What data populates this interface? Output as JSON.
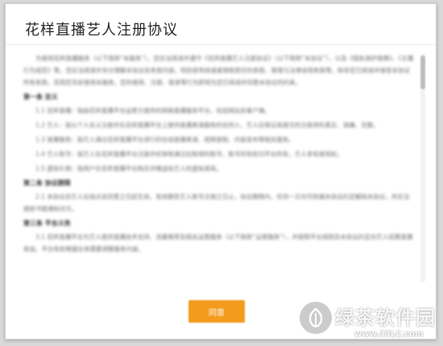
{
  "dialog": {
    "title": "花样直播艺人注册协议",
    "agree_button": "同意"
  },
  "agreement": {
    "intro": "为使用花样直播服务（以下简称“本服务”），您应当阅读并遵守《花样直播艺人注册协议》（以下简称“本协议”），以及《隐私保护政策》、《主播行为规范》等。您应当阅读并充分理解本协议各条款内容，特别是免除或者限制责任的条款、管辖与法律适用条款等。除非您已阅读并接受本协议所有条款，否则您无权使用本服务。您的使用、注册、登录等行为即视为您已阅读并同意本协议的约束。",
    "sections": [
      {
        "heading": "第一条 定义",
        "paragraphs": [
          "1.1 花样直播：指由花样直播平台运营方提供的网络直播服务平台，包括网站及客户端。",
          "1.2 艺人：指以个人名义注册并在花样直播平台上提供直播表演服务的自然人，艺人应保证其提交的注册资料真实、准确、完整。",
          "1.3 直播服务：指艺人通过花样直播平台进行的在线直播表演、视频录制、内容发布等相关服务。",
          "1.4 艺人账号：指艺人在花样直播平台注册并经审核通过后取得的账号，账号所有权归平台所有，艺人享有使用权。",
          "1.5 虚拟礼物：指用户在花样直播平台购买并赠送给艺人的虚拟道具。"
        ]
      },
      {
        "heading": "第二条 协议期限",
        "paragraphs": [
          "2.1 本协议自艺人在线点击同意之日起生效，有效期至艺人账号注销之日止。协议期限内，任何一方均可依据本协议约定解除本协议，并应当提前书面通知对方。"
        ]
      },
      {
        "heading": "第三条 平台义务",
        "paragraphs": [
          "3.1 花样直播平台为艺人提供直播技术支持、流量推荐及相关运营服务（以下简称“运营服务”），并按照平台规则及本协议约定向艺人结算直播收益。平台有权根据业务需要调整服务内容。"
        ]
      }
    ]
  },
  "watermark": {
    "name": "绿茶软件园",
    "url": "www.33LC.com"
  }
}
